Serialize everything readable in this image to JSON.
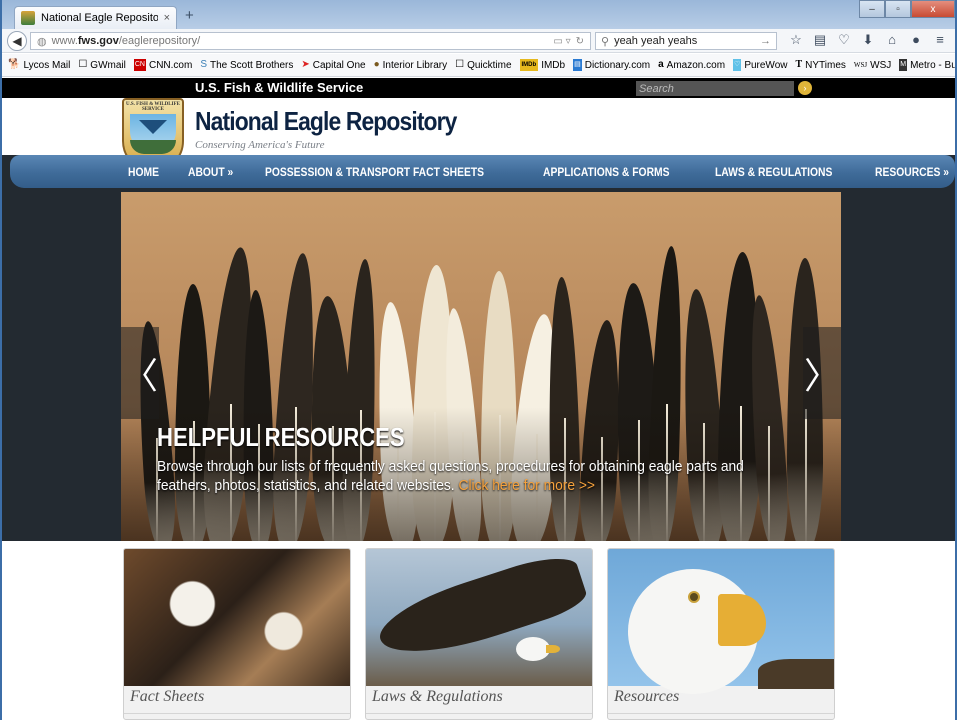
{
  "browser": {
    "tab_title": "National Eagle Repository",
    "tab_close": "×",
    "new_tab": "+",
    "url_prefix": "www.",
    "url_domain": "fws.gov",
    "url_path": "/eaglerepository/",
    "search_value": "yeah yeah yeahs",
    "window_controls": [
      "–",
      "▫",
      "x"
    ]
  },
  "bookmarks": [
    {
      "icon": "lycos-icon",
      "label": "Lycos Mail"
    },
    {
      "icon": "page-icon",
      "label": "GWmail"
    },
    {
      "icon": "cnn-icon",
      "label": "CNN.com"
    },
    {
      "icon": "s-icon",
      "label": "The Scott Brothers"
    },
    {
      "icon": "capitalone-icon",
      "label": "Capital One"
    },
    {
      "icon": "interior-icon",
      "label": "Interior Library"
    },
    {
      "icon": "page-icon",
      "label": "Quicktime"
    },
    {
      "icon": "imdb-icon",
      "label": "IMDb"
    },
    {
      "icon": "dictionary-icon",
      "label": "Dictionary.com"
    },
    {
      "icon": "amazon-icon",
      "label": "Amazon.com"
    },
    {
      "icon": "purewow-icon",
      "label": "PureWow"
    },
    {
      "icon": "nytimes-icon",
      "label": "NYTimes"
    },
    {
      "icon": "wsj-icon",
      "label": "WSJ"
    },
    {
      "icon": "metro-icon",
      "label": "Metro - Bus - Better Bus"
    }
  ],
  "site": {
    "agency": "U.S. Fish & Wildlife Service",
    "search_placeholder": "Search",
    "logo_text": "U.S. FISH & WILDLIFE SERVICE",
    "title": "National Eagle Repository",
    "tagline": "Conserving America's Future"
  },
  "menu": [
    "HOME",
    "ABOUT »",
    "POSSESSION & TRANSPORT FACT SHEETS",
    "APPLICATIONS & FORMS",
    "LAWS & REGULATIONS",
    "RESOURCES »"
  ],
  "hero": {
    "title": "HELPFUL RESOURCES",
    "text": "Browse through our lists of frequently asked questions, procedures for obtaining eagle parts and feathers, photos, statistics, and related websites.",
    "link": "Click here for more >>",
    "prev": "〈",
    "next": "〉"
  },
  "cards": [
    {
      "label": "Fact Sheets"
    },
    {
      "label": "Laws & Regulations"
    },
    {
      "label": "Resources"
    }
  ]
}
